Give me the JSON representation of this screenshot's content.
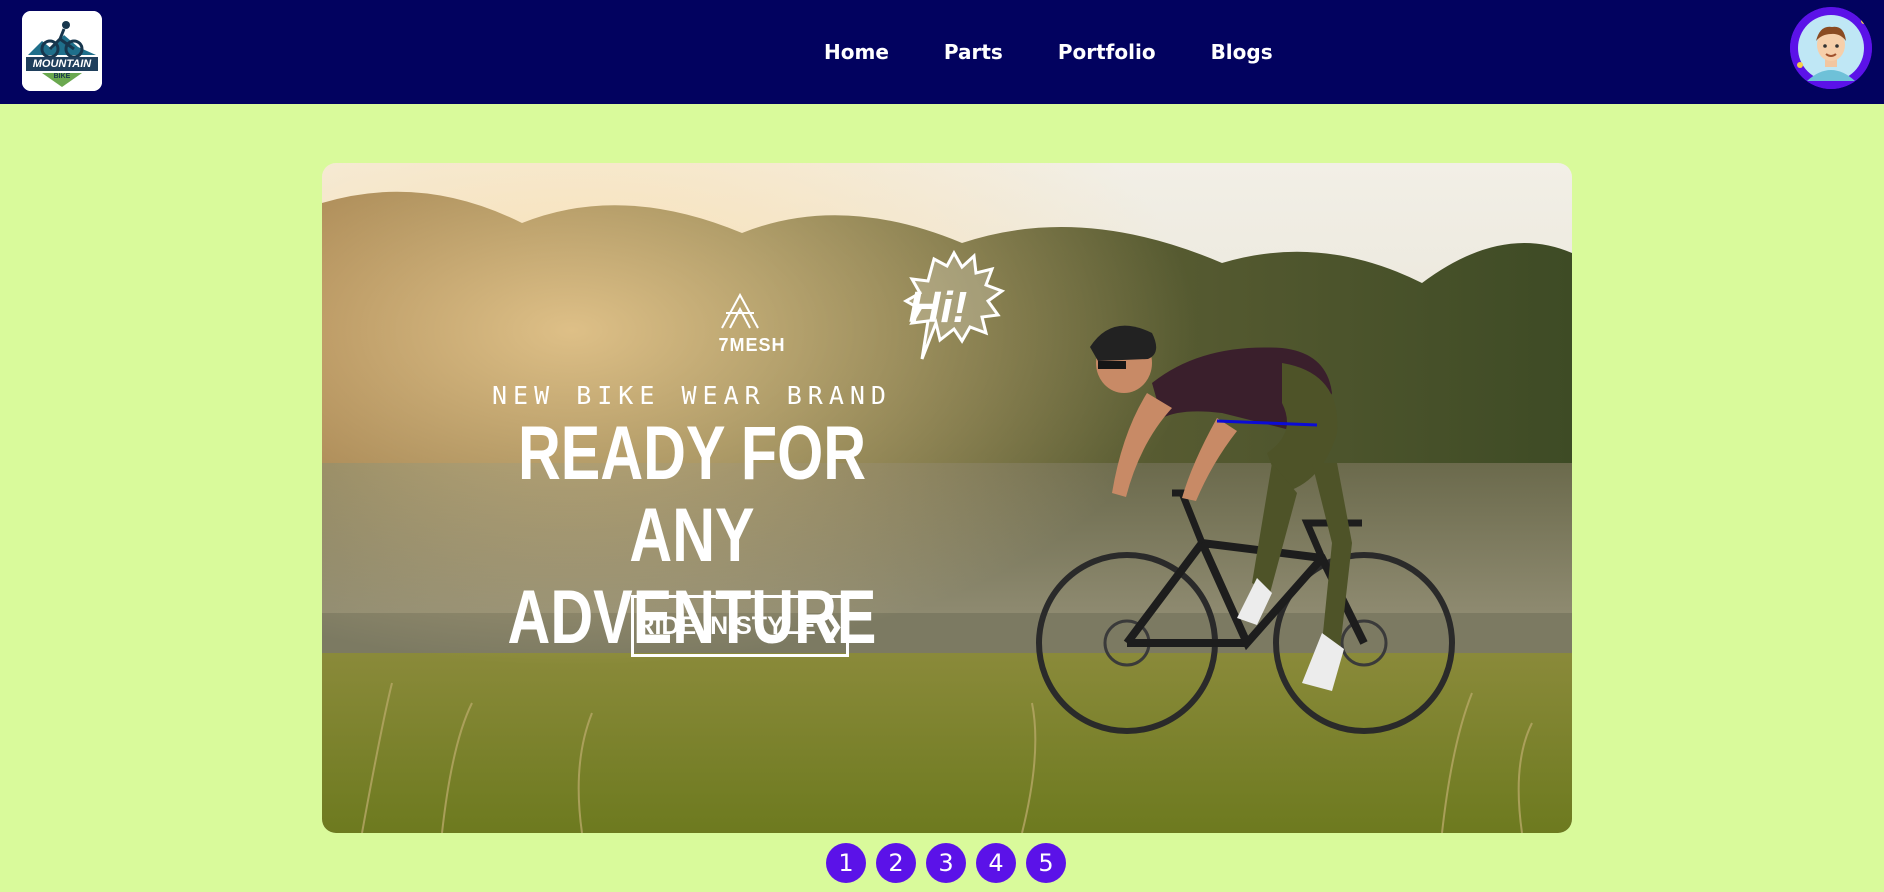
{
  "header": {
    "logo": {
      "text_top": "MOUNTAIN",
      "text_bottom": "BIKE",
      "icon": "mountain-bike-logo-icon"
    },
    "nav": [
      {
        "label": "Home"
      },
      {
        "label": "Parts"
      },
      {
        "label": "Portfolio"
      },
      {
        "label": "Blogs"
      }
    ],
    "avatar": {
      "icon": "user-avatar-icon"
    }
  },
  "banner": {
    "brand": "7MESH",
    "speech": "Hi!",
    "tagline": "NEW BIKE WEAR BRAND",
    "headline_line1": "READY FOR",
    "headline_line2": "ANY ADVENTURE",
    "cta": "RIDE IN STYLE ❯"
  },
  "pagination": [
    {
      "label": "1"
    },
    {
      "label": "2"
    },
    {
      "label": "3"
    },
    {
      "label": "4"
    },
    {
      "label": "5"
    }
  ],
  "colors": {
    "navbar": "#02025f",
    "page_background": "#d9fa9b",
    "accent": "#5b12e8"
  }
}
